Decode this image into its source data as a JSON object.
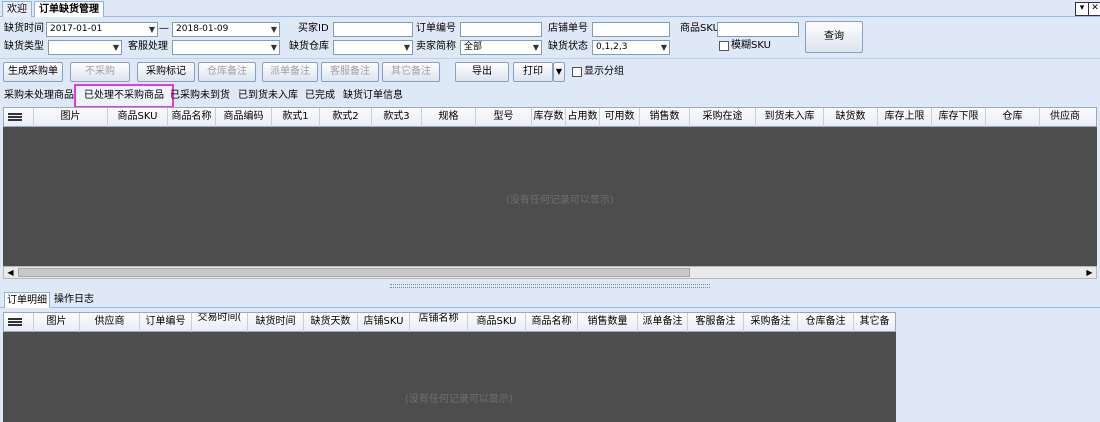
{
  "top_tabs": [
    {
      "label": "欢迎"
    },
    {
      "label": "订单缺货管理"
    }
  ],
  "filter": {
    "shortage_time_label": "缺货时间",
    "date_from": "2017-01-01",
    "date_sep": "—",
    "date_to": "2018-01-09",
    "buyer_id_label": "买家ID",
    "order_no_label": "订单编号",
    "shop_no_label": "店铺单号",
    "sku_label": "商品SKU",
    "query_button": "查询",
    "shortage_type_label": "缺货类型",
    "cs_label": "客服处理",
    "warehouse_label": "缺货仓库",
    "seller_label": "卖家简称",
    "seller_value": "全部",
    "status_label": "缺货状态",
    "status_value": "0,1,2,3",
    "fuzzy_sku_label": "模糊SKU"
  },
  "toolbar": {
    "generate_po": "生成采购单",
    "no_purchase": "不采购",
    "purchase_mark": "采购标记",
    "warehouse_note": "仓库备注",
    "dispatch_note": "派单备注",
    "cs_note": "客服备注",
    "other_note": "其它备注",
    "export": "导出",
    "print": "打印",
    "show_group": "显示分组"
  },
  "sub_tabs": [
    {
      "label": "采购未处理商品"
    },
    {
      "label": "已处理不采购商品"
    },
    {
      "label": "已采购未到货"
    },
    {
      "label": "已到货未入库"
    },
    {
      "label": "已完成"
    },
    {
      "label": "缺货订单信息"
    }
  ],
  "main_grid": {
    "columns": [
      "图片",
      "商品SKU",
      "商品名称",
      "商品编码",
      "款式1",
      "款式2",
      "款式3",
      "规格",
      "型号",
      "库存数",
      "占用数",
      "可用数",
      "销售数",
      "采购在途",
      "到货未入库",
      "缺货数",
      "库存上限",
      "库存下限",
      "仓库",
      "供应商"
    ],
    "empty_text": "(没有任何记录可以显示)"
  },
  "bottom_tabs": [
    {
      "label": "订单明细"
    },
    {
      "label": "操作日志"
    }
  ],
  "detail_grid": {
    "columns": [
      "图片",
      "供应商",
      "订单编号",
      "交易时间(",
      "缺货时间",
      "缺货天数",
      "店铺SKU",
      "店铺名称",
      "商品SKU",
      "商品名称",
      "销售数量",
      "派单备注",
      "客服备注",
      "采购备注",
      "仓库备注",
      "其它备"
    ],
    "empty_text": "(没有任何记录可以显示)"
  },
  "window_buttons": {
    "minimize": "▾",
    "close": "✕"
  },
  "colors": {
    "highlight_border": "#e43be0",
    "grid_bg": "#4d4d4d",
    "panel_bg": "#dfe8f6"
  }
}
